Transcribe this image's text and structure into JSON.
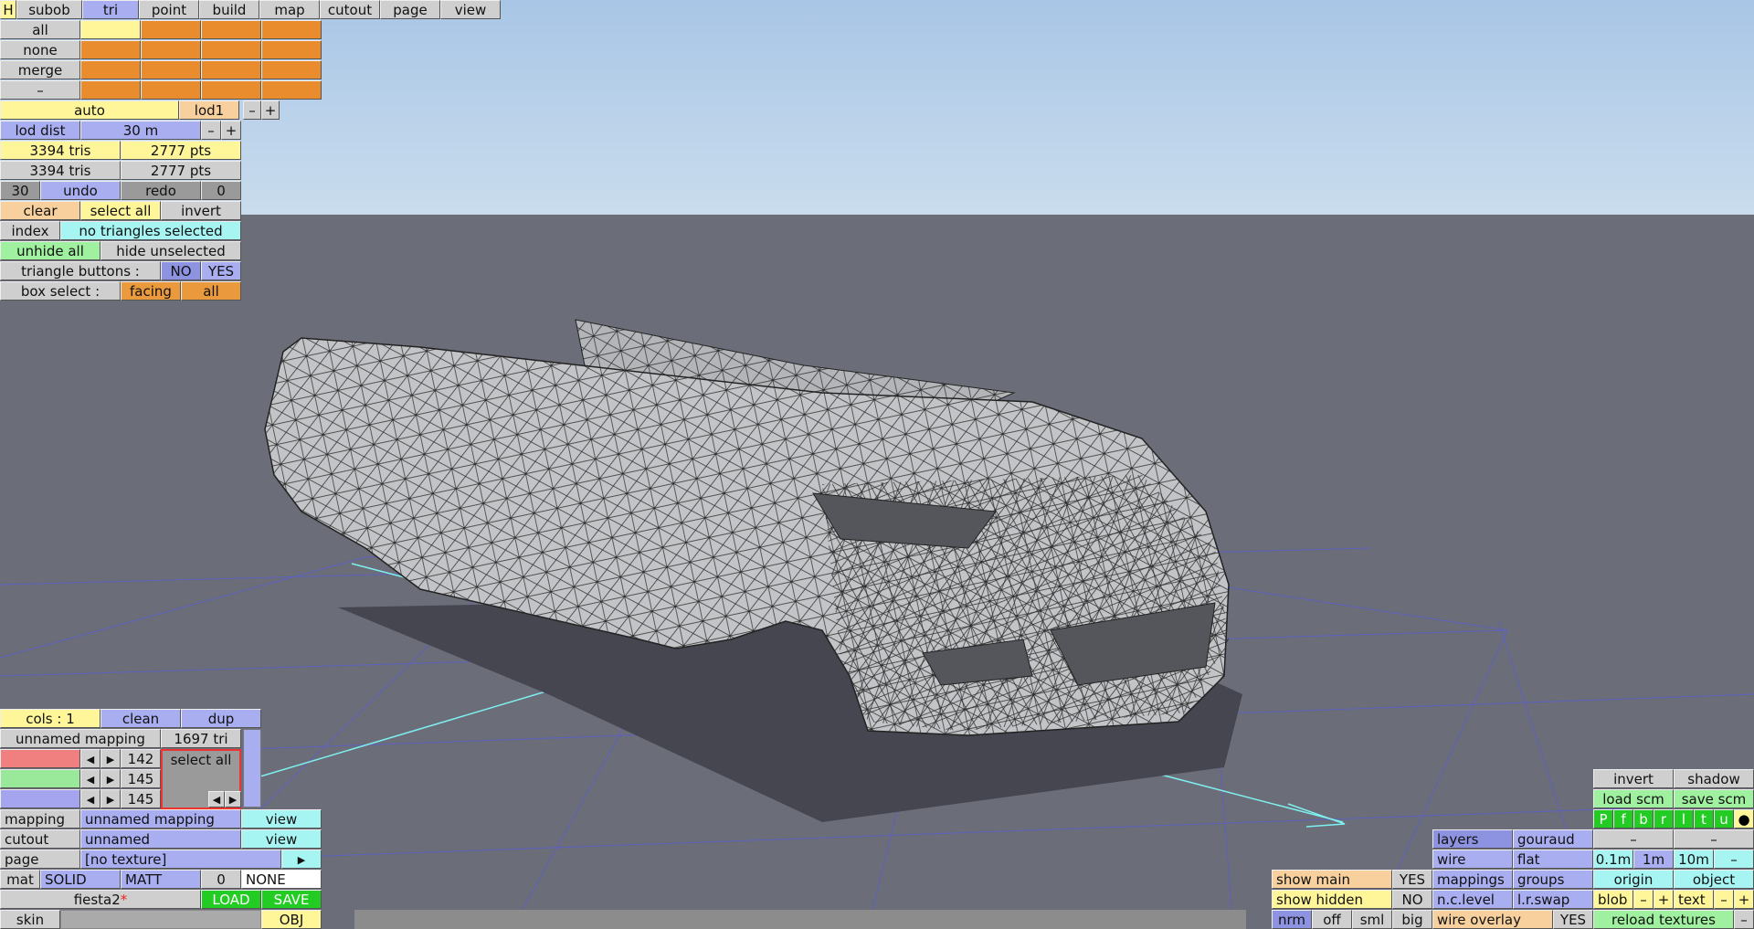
{
  "menu": {
    "h": "H",
    "subob": "subob",
    "tri": "tri",
    "point": "point",
    "build": "build",
    "map": "map",
    "cutout": "cutout",
    "page": "page",
    "view": "view"
  },
  "select": {
    "all": "all",
    "none": "none",
    "merge": "merge",
    "minus": "–"
  },
  "lod": {
    "auto": "auto",
    "name": "lod1",
    "minus": "–",
    "plus": "+",
    "dist_label": "lod dist",
    "dist_value": "30 m"
  },
  "stats": {
    "tris1": "3394 tris",
    "pts1": "2777 pts",
    "tris2": "3394 tris",
    "pts2": "2777 pts"
  },
  "history": {
    "undo_count": "30",
    "undo": "undo",
    "redo": "redo",
    "redo_count": "0"
  },
  "tri_panel": {
    "clear": "clear",
    "select_all": "select all",
    "invert": "invert",
    "index": "index",
    "status": "no triangles selected",
    "unhide_all": "unhide all",
    "hide_unselected": "hide unselected",
    "triangle_buttons": "triangle buttons :",
    "no": "NO",
    "yes": "YES",
    "box_select": "box select :",
    "facing": "facing",
    "all": "all"
  },
  "mapping_panel": {
    "cols": "cols : 1",
    "clean": "clean",
    "dup": "dup",
    "mapping_name": "unnamed mapping",
    "tri_count": "1697 tri",
    "v1": "142",
    "v2": "145",
    "v3": "145",
    "select_all": "select all",
    "left": "◀",
    "right": "▶"
  },
  "props": {
    "mapping_label": "mapping",
    "mapping_value": "unnamed mapping",
    "view": "view",
    "cutout_label": "cutout",
    "cutout_value": "unnamed",
    "page_label": "page",
    "page_value": "[no texture]",
    "play": "▶",
    "mat": "mat",
    "solid": "SOLID",
    "matt": "MATT",
    "num": "0",
    "none": "NONE",
    "file": "fiesta2",
    "modified": "*",
    "load": "LOAD",
    "save": "SAVE",
    "skin": "skin",
    "obj": "OBJ"
  },
  "right_panel": {
    "invert": "invert",
    "shadow": "shadow",
    "load_scm": "load scm",
    "save_scm": "save scm",
    "views": [
      "P",
      "f",
      "b",
      "r",
      "l",
      "t",
      "u",
      "●"
    ],
    "dash": "–",
    "layers": "layers",
    "gouraud": "gouraud",
    "wire": "wire",
    "flat": "flat",
    "g1": "0.1m",
    "g2": "1m",
    "g3": "10m",
    "gminus": "–",
    "show_main": "show main",
    "yes": "YES",
    "show_hidden": "show hidden",
    "no": "NO",
    "mappings": "mappings",
    "groups": "groups",
    "origin": "origin",
    "object": "object",
    "nclevel": "n.c.level",
    "lrswap": "l.r.swap",
    "blob": "blob",
    "minus": "–",
    "plus": "+",
    "text": "text",
    "nrm": "nrm",
    "off": "off",
    "sml": "sml",
    "big": "big",
    "wire_overlay": "wire overlay",
    "reload": "reload textures"
  },
  "colors": {
    "blue": "#a9aef0",
    "yellow": "#fff69a",
    "orange": "#e88c2e",
    "cyan": "#a6f5f3",
    "green": "#9ff09f",
    "gray": "#cfcfcf"
  }
}
